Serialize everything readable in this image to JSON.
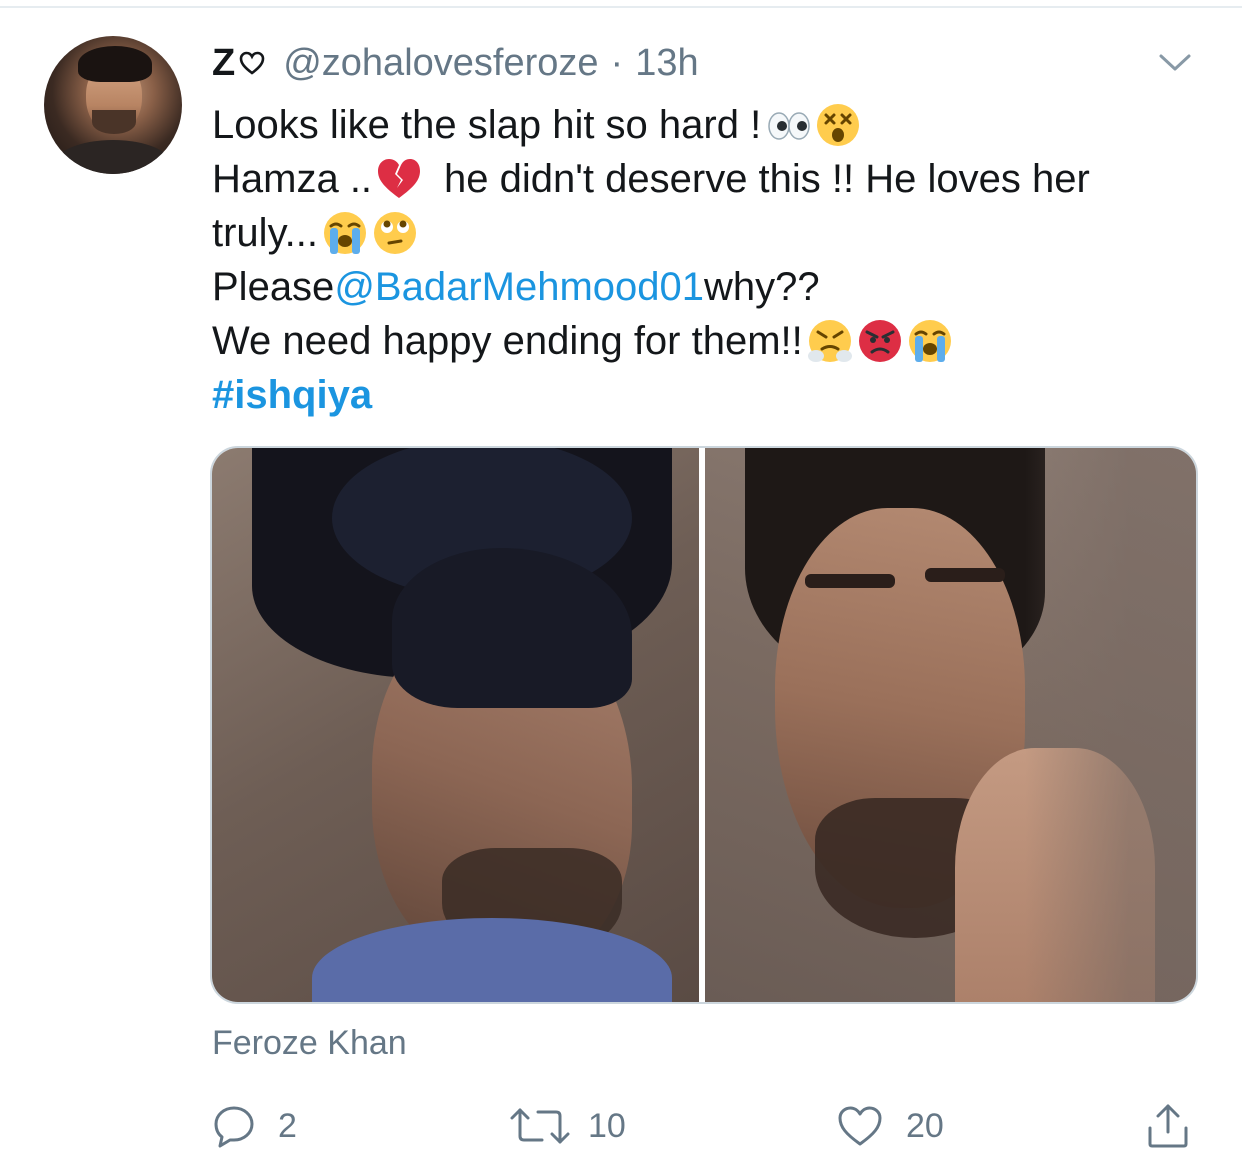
{
  "tweet": {
    "display_name": "Z",
    "handle": "@zohalovesferoze",
    "separator": "·",
    "time": "13h",
    "lines": {
      "l1": "Looks like the slap hit so hard !",
      "l2a": "Hamza ..",
      "l2b": "he didn't deserve this !! He loves her",
      "l3": "truly...",
      "l4a": "Please ",
      "l4_mention": "@BadarMehmood01",
      "l4b": " why??",
      "l5": "We need happy ending for them!!",
      "l6_hashtag": "#ishqiya"
    },
    "media_caption": "Feroze Khan",
    "counts": {
      "replies": "2",
      "retweets": "10",
      "likes": "20"
    }
  },
  "colors": {
    "text": "#14171a",
    "secondary": "#657786",
    "link": "#1b95e0",
    "border": "#ccd6dd"
  },
  "icons": {
    "reply": "reply-icon",
    "retweet": "retweet-icon",
    "like": "heart-icon",
    "share": "share-icon",
    "menu": "chevron-down-icon"
  }
}
